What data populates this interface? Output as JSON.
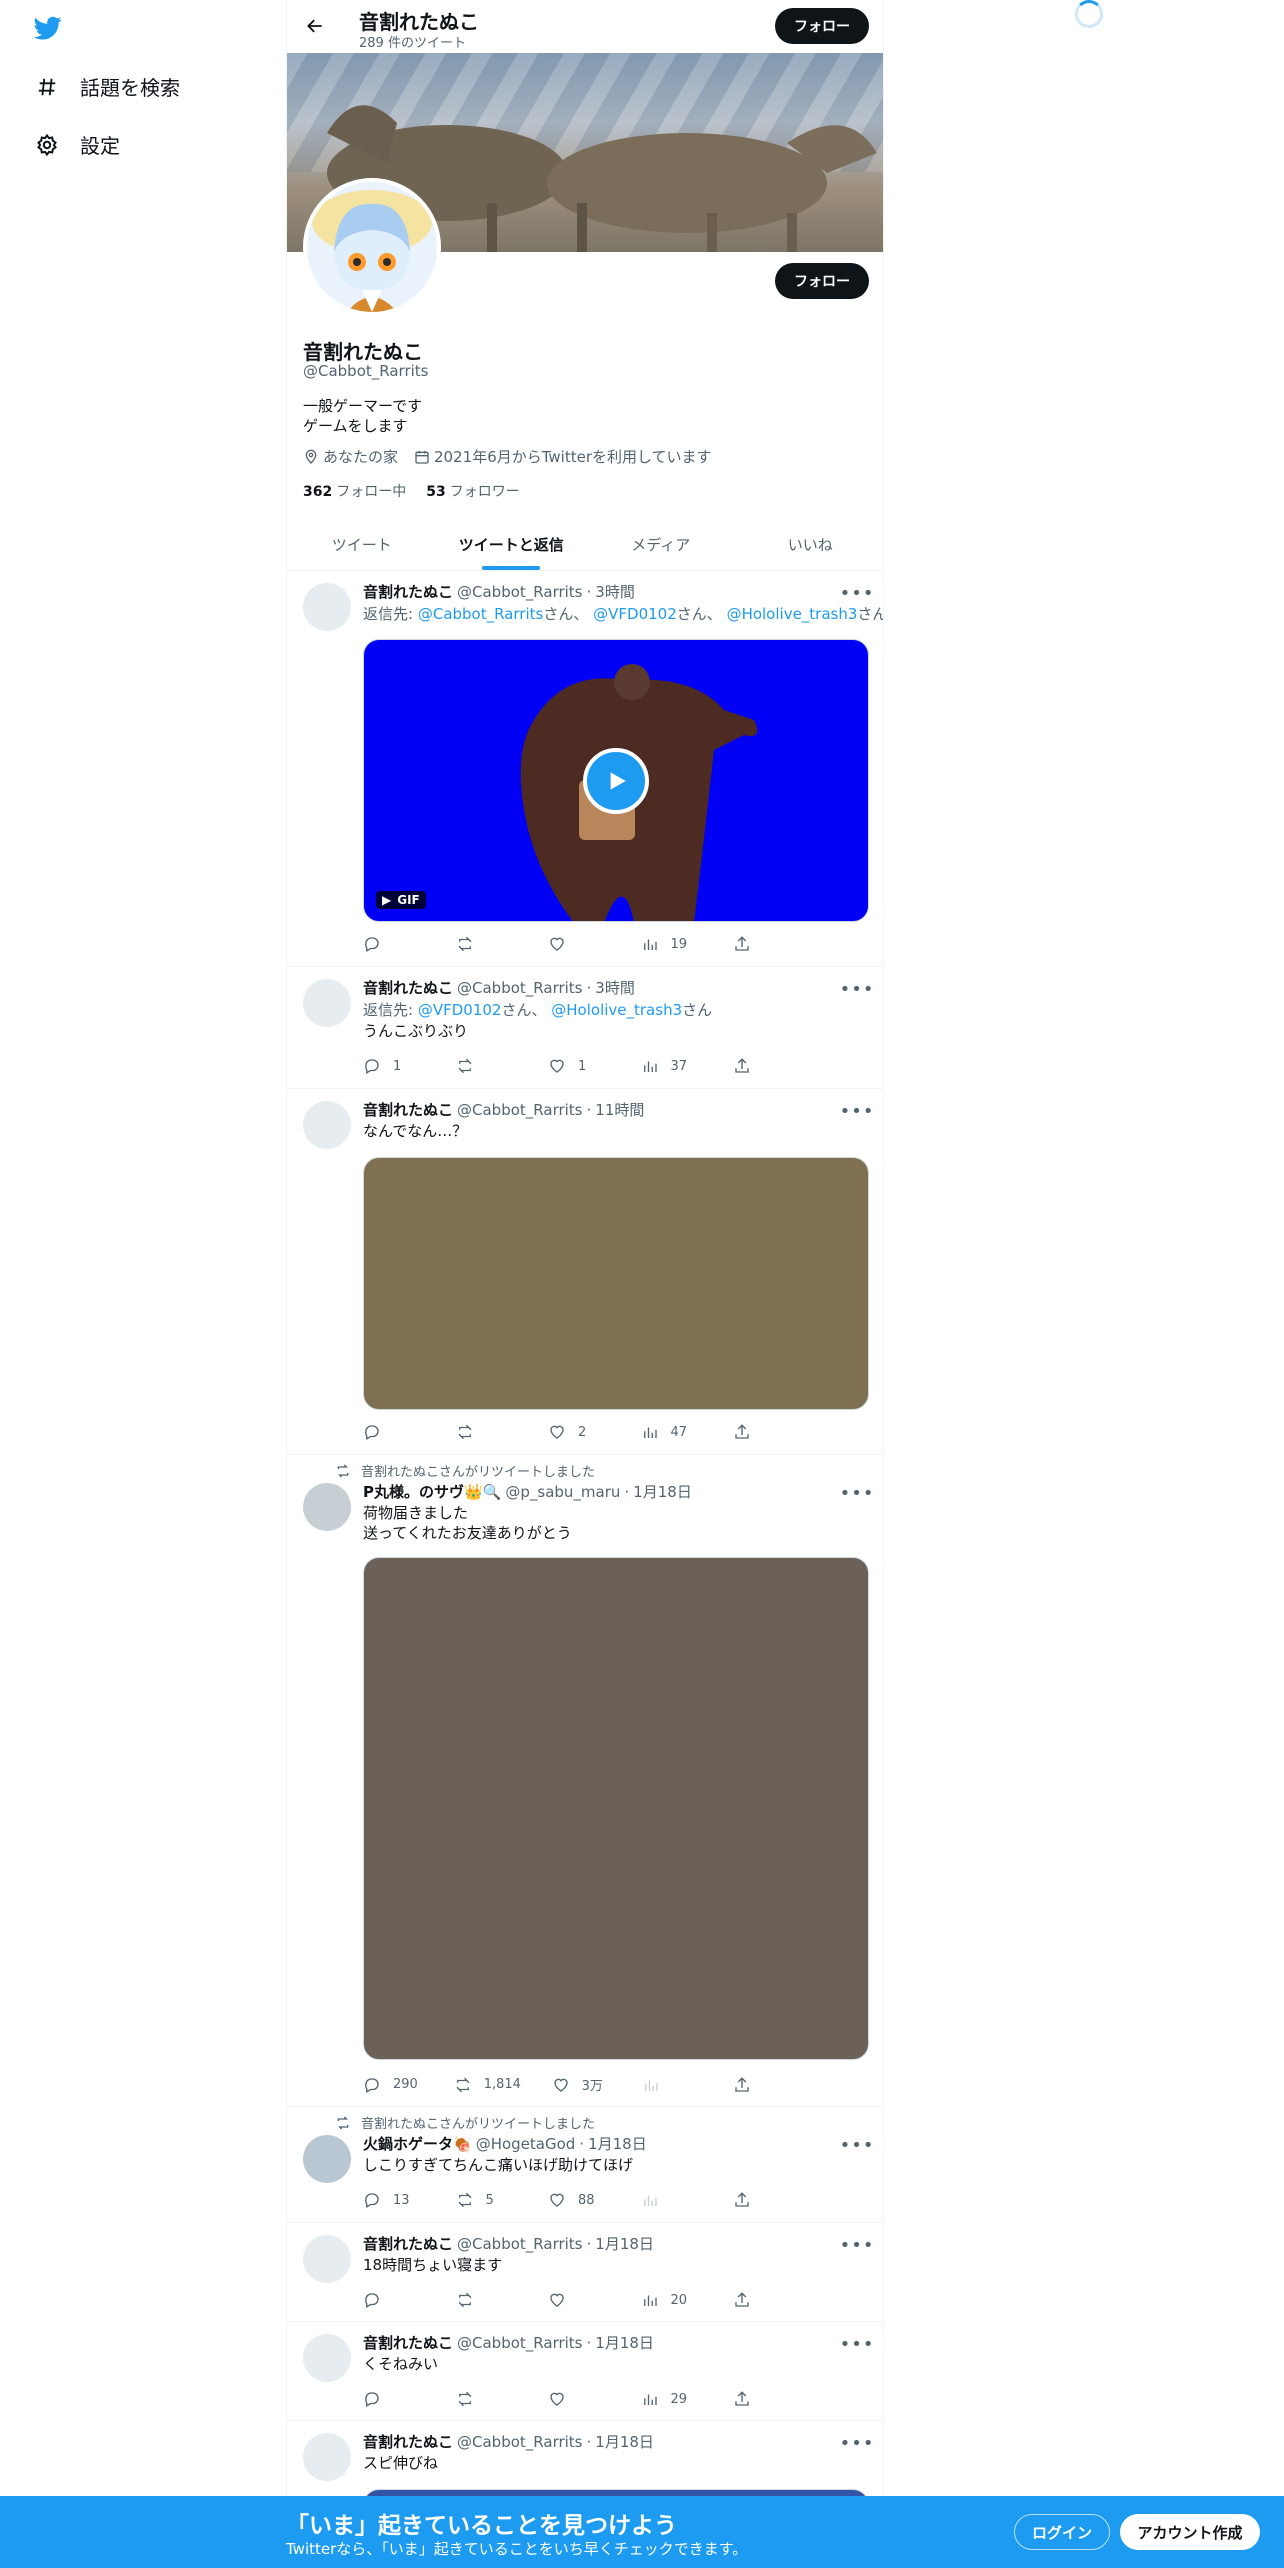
{
  "nav": {
    "items": [
      {
        "label": "話題を検索",
        "icon": "hashtag-icon"
      },
      {
        "label": "設定",
        "icon": "gear-icon"
      }
    ]
  },
  "header": {
    "title": "音割れたぬこ",
    "subtitle": "289 件のツイート",
    "follow_label": "フォロー"
  },
  "profile": {
    "name": "音割れたぬこ",
    "handle": "@Cabbot_Rarrits",
    "bio_line1": "一般ゲーマーです",
    "bio_line2": "ゲームをします",
    "location": "あなたの家",
    "joined": "2021年6月からTwitterを利用しています",
    "following_count": "362",
    "following_label": "フォロー中",
    "followers_count": "53",
    "followers_label": "フォロワー",
    "follow_label": "フォロー"
  },
  "tabs": [
    {
      "label": "ツイート",
      "active": false
    },
    {
      "label": "ツイートと返信",
      "active": true
    },
    {
      "label": "メディア",
      "active": false
    },
    {
      "label": "いいね",
      "active": false
    }
  ],
  "tweets": [
    {
      "name": "音割れたぬこ",
      "handle": "@Cabbot_Rarrits",
      "sep": "·",
      "time": "3時間",
      "reply_prefix": "返信先:",
      "reply_m1": "@Cabbot_Rarrits",
      "reply_s1": "さん、",
      "reply_m2": "@VFD0102",
      "reply_s2": "さん、",
      "reply_m3": "@Hololive_trash3",
      "reply_s3": "さん",
      "media_badge": "GIF",
      "media_color": "#0000f5",
      "replies": "",
      "retweets": "",
      "likes": "",
      "views": "19"
    },
    {
      "name": "音割れたぬこ",
      "handle": "@Cabbot_Rarrits",
      "sep": "·",
      "time": "3時間",
      "reply_prefix": "返信先:",
      "reply_m1": "@VFD0102",
      "reply_s1": "さん、",
      "reply_m2": "@Hololive_trash3",
      "reply_s2": "さん",
      "text": "うんこぶりぶり",
      "replies": "1",
      "retweets": "",
      "likes": "1",
      "views": "37"
    },
    {
      "name": "音割れたぬこ",
      "handle": "@Cabbot_Rarrits",
      "sep": "·",
      "time": "11時間",
      "text": "なんでなん…？",
      "media_color": "#807053",
      "replies": "",
      "retweets": "",
      "likes": "2",
      "views": "47"
    },
    {
      "retweeted_by": "音割れたぬこさんがリツイートしました",
      "name": "P丸様。のサヴ👑🔍",
      "handle": "@p_sabu_maru",
      "sep": "·",
      "time": "1月18日",
      "text_line1": "荷物届きました",
      "text_line2": "送ってくれたお友達ありがとう",
      "media_color": "#6c6158",
      "replies": "290",
      "retweets": "1,814",
      "likes": "3万",
      "views": ""
    },
    {
      "retweeted_by": "音割れたぬこさんがリツイートしました",
      "name": "火鍋ホゲータ🍖",
      "handle": "@HogetaGod",
      "sep": "·",
      "time": "1月18日",
      "text": "しこりすぎてちんこ痛いほげ助けてほげ",
      "replies": "13",
      "retweets": "5",
      "likes": "88",
      "views": ""
    },
    {
      "name": "音割れたぬこ",
      "handle": "@Cabbot_Rarrits",
      "sep": "·",
      "time": "1月18日",
      "text": "18時間ちょい寝ます",
      "replies": "",
      "retweets": "",
      "likes": "",
      "views": "20"
    },
    {
      "name": "音割れたぬこ",
      "handle": "@Cabbot_Rarrits",
      "sep": "·",
      "time": "1月18日",
      "text": "くそねみい",
      "replies": "",
      "retweets": "",
      "likes": "",
      "views": "29"
    },
    {
      "name": "音割れたぬこ",
      "handle": "@Cabbot_Rarrits",
      "sep": "·",
      "time": "1月18日",
      "text": "スピ伸びね"
    }
  ],
  "bottom_bar": {
    "title": "「いま」起きていることを見つけよう",
    "subtitle": "Twitterなら、「いま」起きていることをいち早くチェックできます。",
    "login_label": "ログイン",
    "signup_label": "アカウント作成"
  },
  "colors": {
    "accent": "#1d9bf0",
    "text": "#0f1419",
    "secondary": "#536471"
  }
}
